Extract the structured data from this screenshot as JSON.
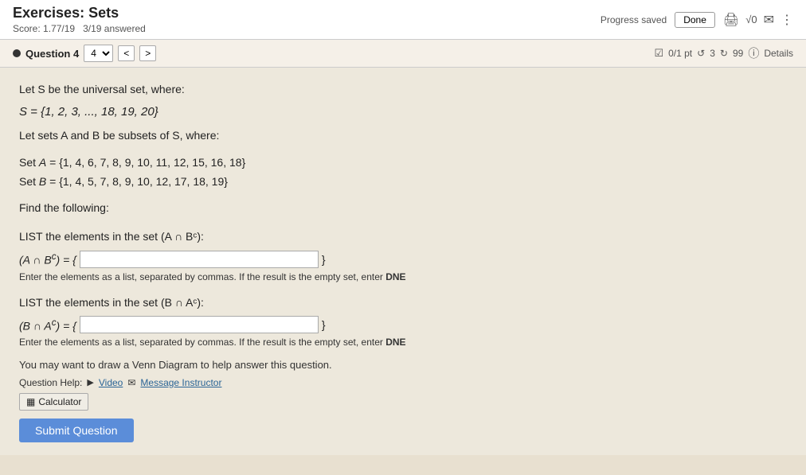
{
  "header": {
    "title": "Exercises: Sets",
    "score_label": "Score: 1.77/19",
    "answered_label": "3/19 answered",
    "progress_saved": "Progress saved",
    "done_button": "Done"
  },
  "question_nav": {
    "question_label": "Question 4",
    "nav_prev": "<",
    "nav_next": ">",
    "points": "0/1 pt",
    "retries": "3",
    "submissions": "99",
    "details_label": "Details"
  },
  "problem": {
    "line1": "Let S be the universal set, where:",
    "line2": "S = {1, 2, 3, ..., 18, 19, 20}",
    "line3": "Let sets A and B be subsets of S, where:",
    "setA": "Set A = {1, 4, 6, 7, 8, 9, 10, 11, 12, 15, 16, 18}",
    "setB": "Set B = {1, 4, 5, 7, 8, 9, 10, 12, 17, 18, 19}",
    "find": "Find the following:",
    "list1_label": "LIST the elements in the set (A ∩ Bᶜ):",
    "input1_prefix": "(A ∩ Bᶜ) = {",
    "input1_suffix": "}",
    "hint1": "Enter the elements as a list, separated by commas. If the result is the empty set, enter DNE",
    "list2_label": "LIST the elements in the set (B ∩ Aᶜ):",
    "input2_prefix": "(B ∩ Aᶜ) = {",
    "input2_suffix": "}",
    "hint2": "Enter the elements as a list, separated by commas. If the result is the empty set, enter DNE",
    "venn_text": "You may want to draw a Venn Diagram to help answer this question.",
    "help_label": "Question Help:",
    "video_label": "Video",
    "message_label": "Message Instructor",
    "calculator_label": "Calculator",
    "submit_label": "Submit Question"
  },
  "icons": {
    "print": "🖨",
    "sqrt": "√0",
    "mail": "✉",
    "dots": "⋮",
    "video": "▶",
    "calculator": "▦"
  }
}
